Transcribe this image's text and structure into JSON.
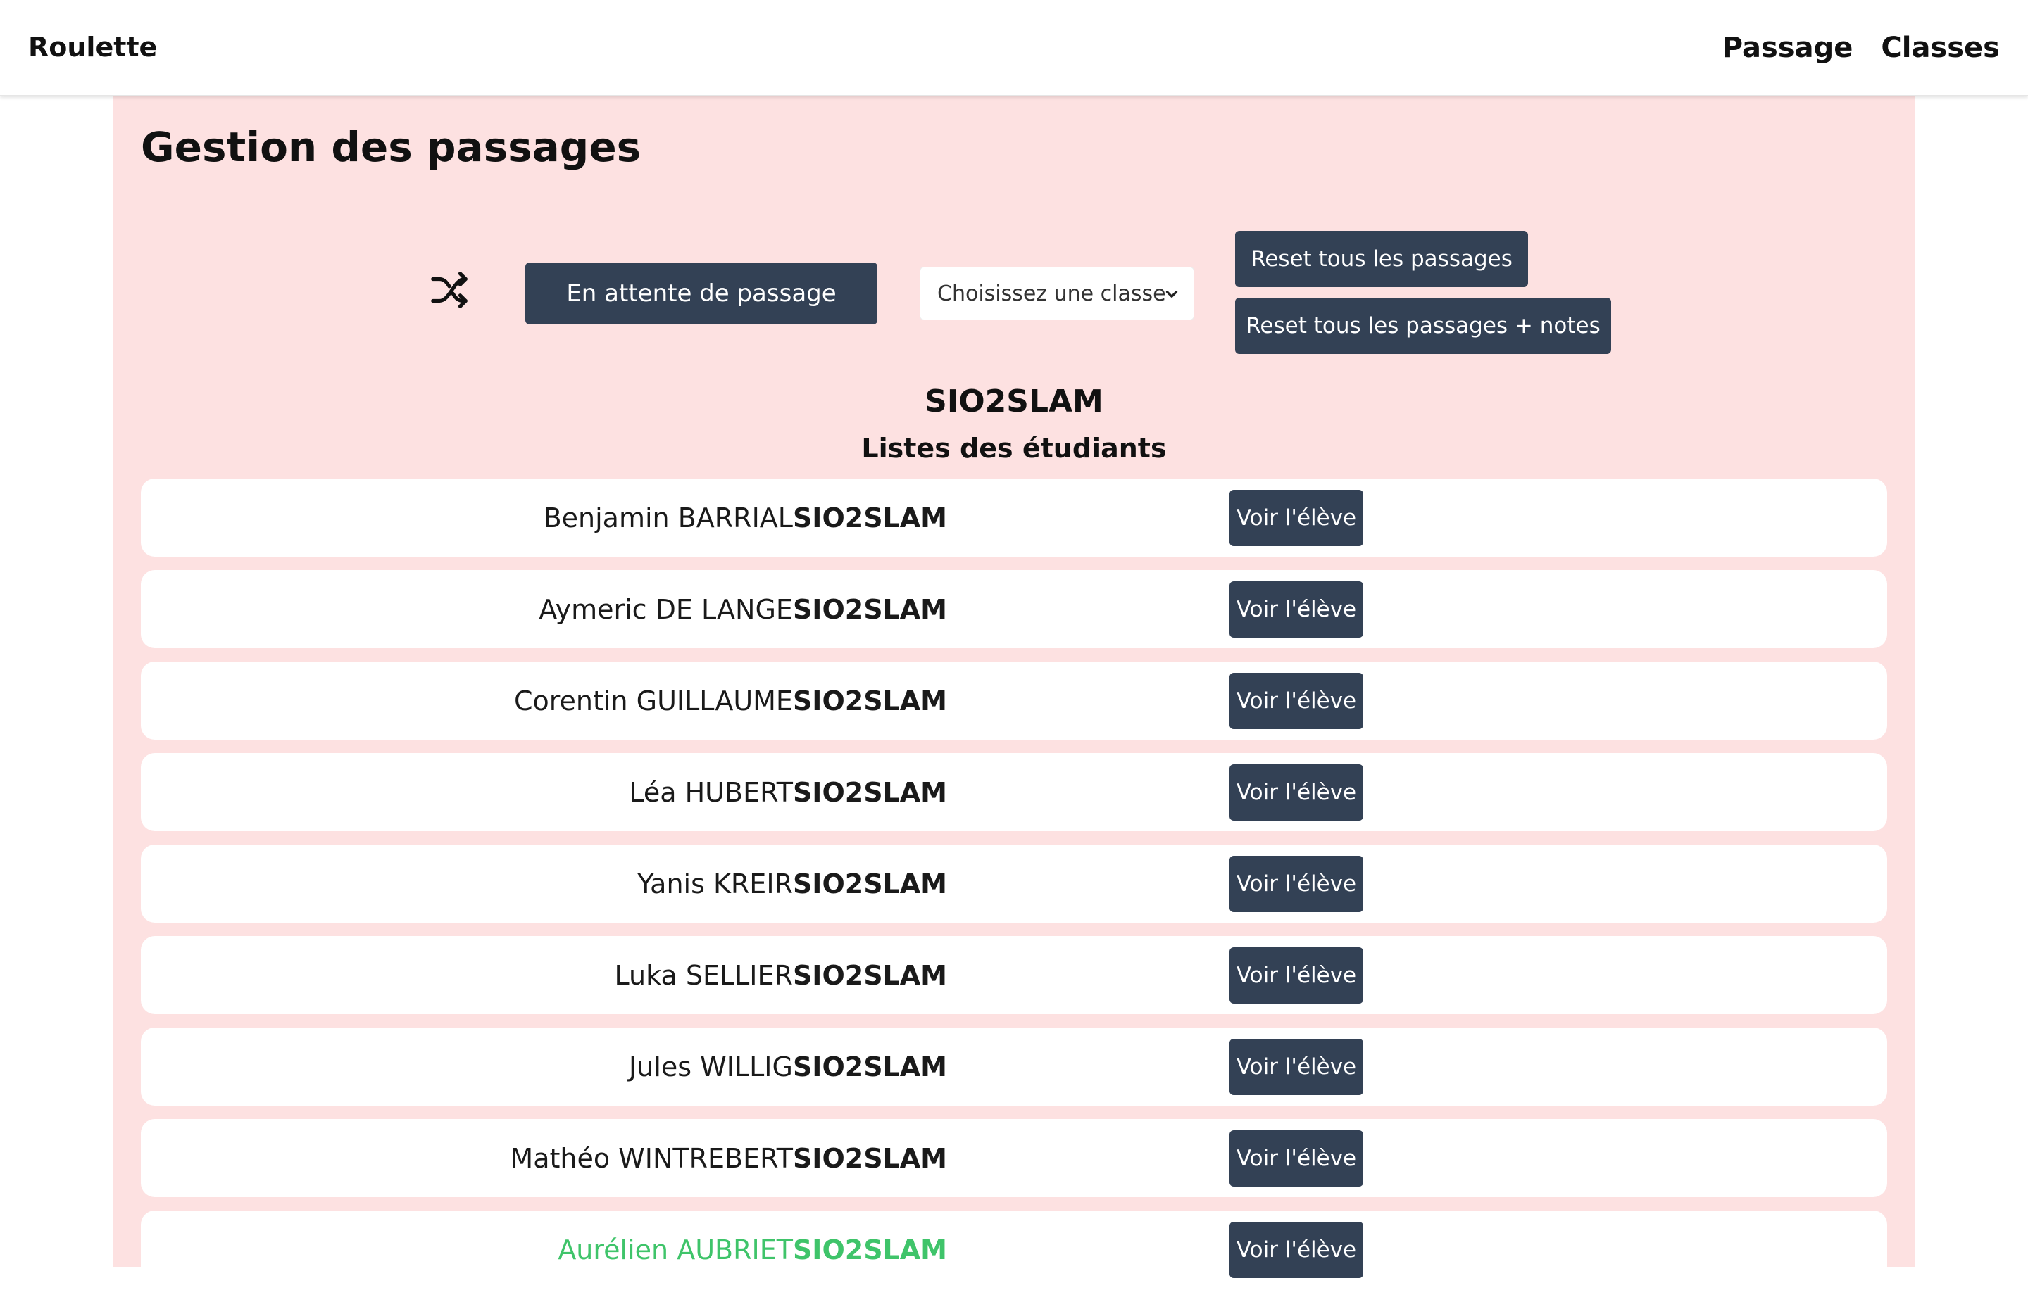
{
  "app": {
    "brand": "Roulette"
  },
  "nav": {
    "links": [
      "Passage",
      "Classes"
    ]
  },
  "page": {
    "title": "Gestion des passages"
  },
  "controls": {
    "shuffle_icon": "shuffle-icon",
    "wait_button": "En attente de passage",
    "class_select": {
      "selected": "Choisissez une classe",
      "icon": "chevron-down-icon"
    },
    "reset_button": "Reset tous les passages",
    "reset_notes_button": "Reset tous les passages + notes"
  },
  "class_section": {
    "class_name": "SIO2SLAM",
    "list_title": "Listes des étudiants"
  },
  "students": [
    {
      "name": "Benjamin BARRIAL",
      "class": "SIO2SLAM",
      "action": "Voir l'élève",
      "current": false
    },
    {
      "name": "Aymeric DE LANGE",
      "class": "SIO2SLAM",
      "action": "Voir l'élève",
      "current": false
    },
    {
      "name": "Corentin GUILLAUME",
      "class": "SIO2SLAM",
      "action": "Voir l'élève",
      "current": false
    },
    {
      "name": "Léa HUBERT",
      "class": "SIO2SLAM",
      "action": "Voir l'élève",
      "current": false
    },
    {
      "name": "Yanis KREIR",
      "class": "SIO2SLAM",
      "action": "Voir l'élève",
      "current": false
    },
    {
      "name": "Luka SELLIER",
      "class": "SIO2SLAM",
      "action": "Voir l'élève",
      "current": false
    },
    {
      "name": "Jules WILLIG",
      "class": "SIO2SLAM",
      "action": "Voir l'élève",
      "current": false
    },
    {
      "name": "Mathéo WINTREBERT",
      "class": "SIO2SLAM",
      "action": "Voir l'élève",
      "current": false
    },
    {
      "name": "Aurélien AUBRIET",
      "class": "SIO2SLAM",
      "action": "Voir l'élève",
      "current": true
    }
  ],
  "colors": {
    "panel_background": "#fde1e1",
    "button_dark": "#334155",
    "highlight_green": "#3fc46a"
  }
}
